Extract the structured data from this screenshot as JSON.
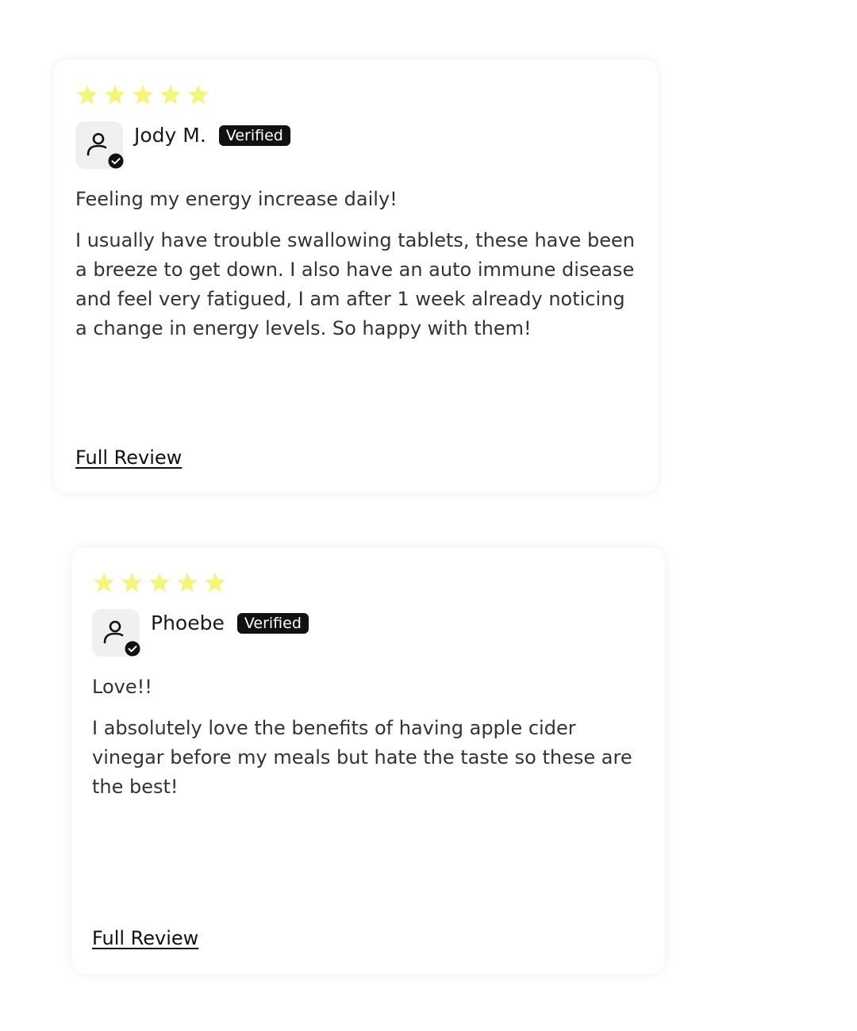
{
  "colors": {
    "star": "#f4f57c",
    "badge_bg": "#111111",
    "badge_text": "#ffffff",
    "avatar_bg": "#f0f0f0",
    "text": "#333333"
  },
  "reviews": [
    {
      "rating": 5,
      "author": "Jody M.",
      "badge": "Verified",
      "title": "Feeling my energy increase daily!",
      "body": "I usually have trouble swallowing tablets, these have been a breeze to get down. I also have an auto immune disease and feel very fatigued, I am after 1 week already noticing a change in energy levels. So happy with them!",
      "link": "Full Review"
    },
    {
      "rating": 5,
      "author": "Phoebe",
      "badge": "Verified",
      "title": "Love!!",
      "body": "I absolutely love the benefits of having apple cider vinegar before my meals but hate the taste so these are the best!",
      "link": "Full Review"
    }
  ]
}
